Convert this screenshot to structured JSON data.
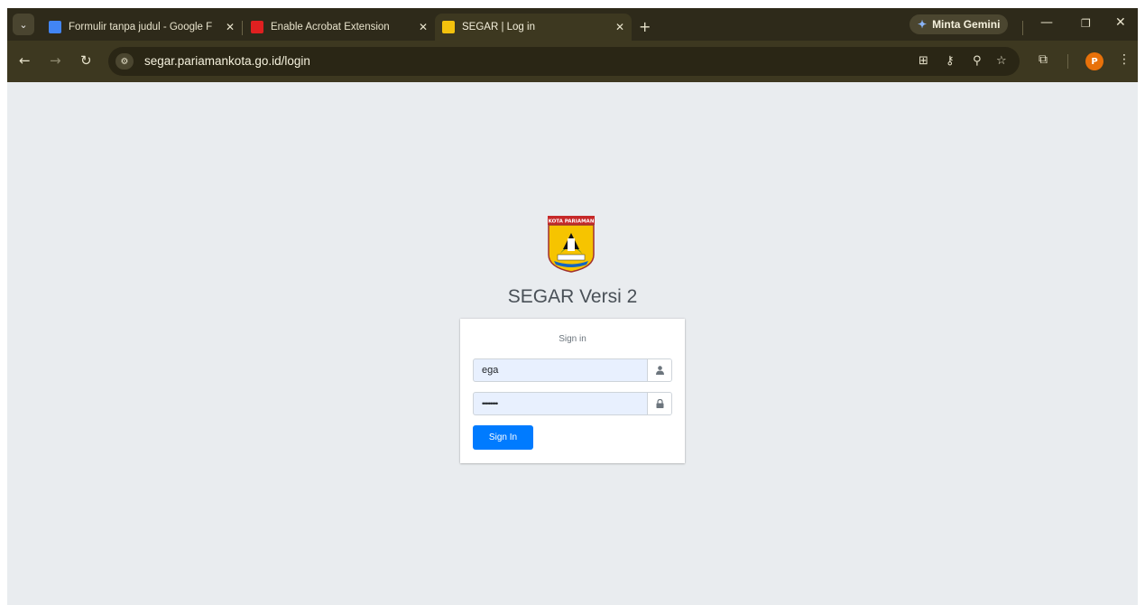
{
  "browser": {
    "tabs": [
      {
        "title": "Formulir tanpa judul - Google F",
        "favicon": "google-forms-icon",
        "favicon_color": "#4285f4"
      },
      {
        "title": "Enable Acrobat Extension",
        "favicon": "acrobat-icon",
        "favicon_color": "#e02020"
      },
      {
        "title": "SEGAR | Log in",
        "favicon": "segar-logo-icon",
        "favicon_color": "#f4c20d",
        "active": true
      }
    ],
    "gemini_label": "Minta Gemini",
    "url": "segar.pariamankota.go.id/login",
    "profile_initial": "P",
    "profile_color": "#e8710a",
    "chrome_color": "#3d3820"
  },
  "page": {
    "logo_text": "KOTA PARIAMAN",
    "title": "SEGAR Versi 2",
    "login_message": "Sign in",
    "username": {
      "value": "ega"
    },
    "password": {
      "value": "••••••••"
    },
    "signin_label": "Sign In",
    "primary_color": "#007bff"
  }
}
